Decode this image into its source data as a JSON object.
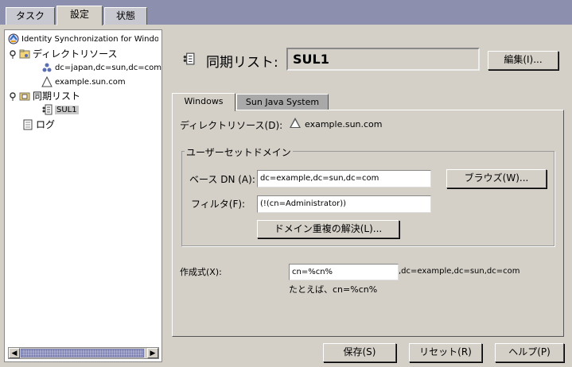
{
  "top_tabs": [
    {
      "label": "タスク"
    },
    {
      "label": "設定"
    },
    {
      "label": "状態"
    }
  ],
  "tree": {
    "root": "Identity Synchronization for Windows",
    "directory_sources": "ディレクトリソース",
    "source_japan": "dc=japan,dc=sun,dc=com",
    "source_example": "example.sun.com",
    "sync_lists": "同期リスト",
    "sul1": "SUL1",
    "log": "ログ"
  },
  "header": {
    "label": "同期リスト:",
    "name": "SUL1",
    "edit_button": "編集(I)..."
  },
  "inner_tabs": [
    {
      "label": "Windows"
    },
    {
      "label": "Sun Java System"
    }
  ],
  "form": {
    "directory_source_label": "ディレクトリソース(D):",
    "directory_source_value": "example.sun.com",
    "group_title": "ユーザーセットドメイン",
    "base_dn_label": "ベース DN (A):",
    "base_dn_value": "dc=example,dc=sun,dc=com",
    "browse_button": "ブラウズ(W)...",
    "filter_label": "フィルタ(F):",
    "filter_value": "(!(cn=Administrator))",
    "resolve_button": "ドメイン重複の解決(L)...",
    "creation_label": "作成式(X):",
    "creation_value": "cn=%cn%",
    "creation_suffix": ",dc=example,dc=sun,dc=com",
    "creation_hint": "たとえば、cn=%cn%"
  },
  "bottom": {
    "save": "保存(S)",
    "reset": "リセット(R)",
    "help": "ヘルプ(P)"
  }
}
